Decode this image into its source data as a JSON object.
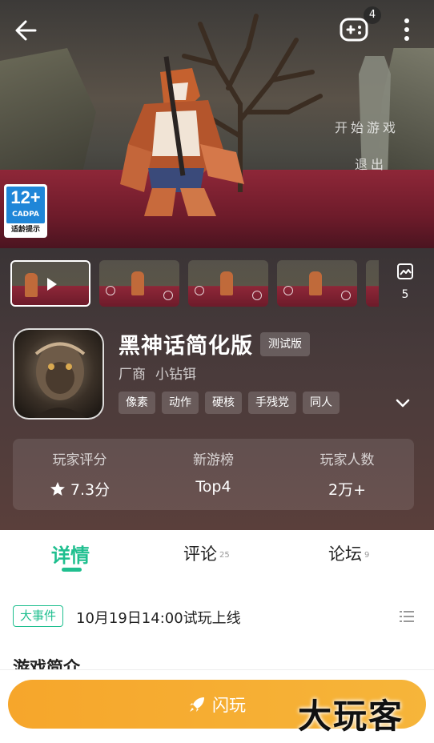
{
  "header": {
    "notification_count": "4",
    "hero_text_start": "开始游戏",
    "hero_text_exit": "退出",
    "age_rating": {
      "number": "12+",
      "org": "CADPA",
      "tip": "适龄提示"
    }
  },
  "media": {
    "more_count": "5"
  },
  "app": {
    "title": "黑神话简化版",
    "beta_label": "测试版",
    "vendor_label": "厂商",
    "vendor_name": "小钻铒",
    "tags": [
      "像素",
      "动作",
      "硬核",
      "手残党",
      "同人"
    ]
  },
  "stats": [
    {
      "label": "玩家评分",
      "value": "7.3分"
    },
    {
      "label": "新游榜",
      "value": "Top4"
    },
    {
      "label": "玩家人数",
      "value": "2万+"
    }
  ],
  "tabs": [
    {
      "label": "详情",
      "count": ""
    },
    {
      "label": "评论",
      "count": "25"
    },
    {
      "label": "论坛",
      "count": "9"
    }
  ],
  "event": {
    "badge": "大事件",
    "text": "10月19日14:00试玩上线"
  },
  "intro": {
    "heading": "游戏简介"
  },
  "bottom": {
    "play_label": "闪玩",
    "watermark": "大玩客"
  },
  "colors": {
    "accent": "#1fbf8f",
    "play_button": "#f6a62b",
    "age_badge_blue": "#1f86d8"
  }
}
